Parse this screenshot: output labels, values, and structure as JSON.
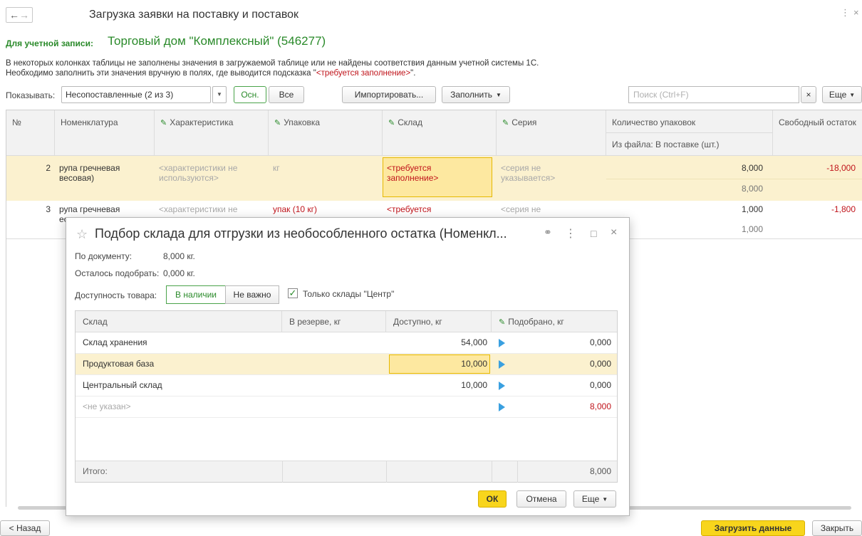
{
  "header": {
    "back_icon": "←",
    "forward_icon": "→",
    "title": "Загрузка заявки на поставку и поставок",
    "more_icon": "⋮",
    "close_icon": "×"
  },
  "account": {
    "label": "Для учетной записи:",
    "value": "Торговый дом \"Комплексный\" (546277)"
  },
  "info": {
    "line1": "В некоторых колонках таблицы не заполнены значения в загружаемой таблице или не найдены соответствия данным учетной системы 1С.",
    "line2_prefix": "Необходимо заполнить эти значения вручную в полях, где выводится подсказка \"",
    "line2_hint": "<требуется заполнение>",
    "line2_suffix": "\"."
  },
  "toolbar": {
    "show_label": "Показывать:",
    "show_value": "Несопоставленные (2 из 3)",
    "osn": "Осн.",
    "all": "Все",
    "import": "Импортировать...",
    "fill": "Заполнить",
    "search_placeholder": "Поиск (Ctrl+F)",
    "clear_icon": "×",
    "more": "Еще"
  },
  "table": {
    "columns": {
      "num": "№",
      "nomenclature": "Номенклатура",
      "characteristic": "Характеристика",
      "package": "Упаковка",
      "warehouse": "Склад",
      "series": "Серия",
      "qty": "Количество упаковок",
      "qty_sub": "Из файла: В поставке (шт.)",
      "free": "Свободный остаток"
    },
    "rows": [
      {
        "num": "2",
        "nom1": "рупа гречневая",
        "nom2": "весовая)",
        "char1": "<характеристики не",
        "char2": "используются>",
        "package": "кг",
        "wh1": "<требуется",
        "wh2": "заполнение>",
        "ser1": "<серия не",
        "ser2": "указывается>",
        "qty": "8,000",
        "qty2": "8,000",
        "free": "-18,000"
      },
      {
        "num": "3",
        "nom1": "рупа гречневая",
        "nom2": "ес",
        "char1": "<характеристики не",
        "package": "упак (10 кг)",
        "wh1": "<требуется",
        "ser1": "<серия не",
        "qty": "1,000",
        "qty2": "1,000",
        "free": "-1,800"
      }
    ]
  },
  "dialog": {
    "star_icon": "☆",
    "title": "Подбор склада для отгрузки из необособленного остатка (Номенкл...",
    "link_icon": "🔗",
    "more_icon": "⋮",
    "max_icon": "□",
    "close_icon": "×",
    "by_doc_label": "По документу:",
    "by_doc_value": "8,000 кг.",
    "remaining_label": "Осталось подобрать:",
    "remaining_value": "0,000 кг.",
    "availability_label": "Доступность товара:",
    "in_stock": "В наличии",
    "not_important": "Не важно",
    "only_center": "Только склады \"Центр\"",
    "columns": {
      "warehouse": "Склад",
      "reserve": "В резерве, кг",
      "available": "Доступно, кг",
      "picked": "Подобрано, кг"
    },
    "rows": [
      {
        "warehouse": "Склад хранения",
        "available": "54,000",
        "picked": "0,000"
      },
      {
        "warehouse": "Продуктовая база",
        "available": "10,000",
        "picked": "0,000"
      },
      {
        "warehouse": "Центральный склад",
        "available": "10,000",
        "picked": "0,000"
      },
      {
        "warehouse": "<не указан>",
        "available": "",
        "picked": "8,000"
      }
    ],
    "total_label": "Итого:",
    "total_value": "8,000",
    "ok": "ОК",
    "cancel": "Отмена",
    "more": "Еще"
  },
  "footer": {
    "back": "< Назад",
    "load": "Загрузить данные",
    "close": "Закрыть"
  }
}
